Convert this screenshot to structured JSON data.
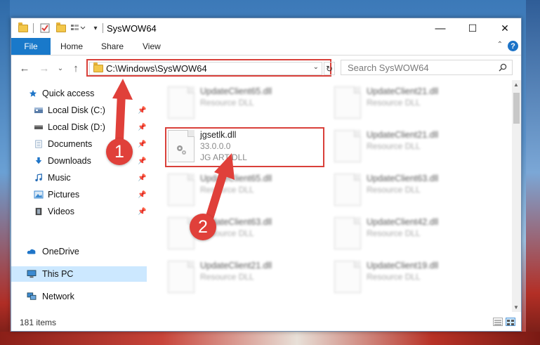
{
  "window": {
    "title": "SysWOW64",
    "controls": {
      "minimize": "—",
      "maximize": "☐",
      "close": "✕"
    }
  },
  "ribbon": {
    "tabs": [
      "File",
      "Home",
      "Share",
      "View"
    ],
    "help": "?",
    "collapse": "⌃"
  },
  "navigation": {
    "back": "←",
    "forward": "→",
    "recent": "⌄",
    "up": "↑",
    "address": "C:\\Windows\\SysWOW64",
    "refresh": "↻",
    "search_placeholder": "Search SysWOW64"
  },
  "sidebar": {
    "items": [
      {
        "label": "Quick access",
        "icon": "star-icon",
        "color": "#1f75c8",
        "pinned": false
      },
      {
        "label": "Local Disk (C:)",
        "icon": "drive-icon",
        "color": "#5a7da8",
        "pinned": true
      },
      {
        "label": "Local Disk (D:)",
        "icon": "drive-icon",
        "color": "#5a5a5a",
        "pinned": true
      },
      {
        "label": "Documents",
        "icon": "documents-icon",
        "color": "#8aa6c4",
        "pinned": true
      },
      {
        "label": "Downloads",
        "icon": "download-arrow-icon",
        "color": "#1f75c8",
        "pinned": true
      },
      {
        "label": "Music",
        "icon": "music-note-icon",
        "color": "#2a6fb7",
        "pinned": true
      },
      {
        "label": "Pictures",
        "icon": "pictures-icon",
        "color": "#3c8ad1",
        "pinned": true
      },
      {
        "label": "Videos",
        "icon": "film-icon",
        "color": "#444444",
        "pinned": true
      },
      {
        "label": "OneDrive",
        "icon": "cloud-icon",
        "color": "#1f75c8",
        "pinned": false
      },
      {
        "label": "This PC",
        "icon": "computer-icon",
        "color": "#3c8ad1",
        "pinned": false,
        "selected": true
      },
      {
        "label": "Network",
        "icon": "network-icon",
        "color": "#3c8ad1",
        "pinned": false
      }
    ],
    "pin_glyph": "📌"
  },
  "files": {
    "left_column": [
      {
        "name": "UpdateClient65.dll",
        "sub": "Resource DLL",
        "blurred": true
      },
      {
        "name": "jgsetlk.dll",
        "version": "33.0.0.0",
        "desc": "JG ART DLL",
        "blurred": false
      },
      {
        "name": "UpdateClient65.dll",
        "sub": "Resource DLL",
        "blurred": true
      },
      {
        "name": "UpdateClient63.dll",
        "sub": "Resource DLL",
        "blurred": true
      },
      {
        "name": "UpdateClient21.dll",
        "sub": "Resource DLL",
        "blurred": true
      }
    ],
    "right_column": [
      {
        "name": "UpdateClient21.dll",
        "sub": "Resource DLL"
      },
      {
        "name": "UpdateClient21.dll",
        "sub": "Resource DLL"
      },
      {
        "name": "UpdateClient63.dll",
        "sub": "Resource DLL"
      },
      {
        "name": "UpdateClient42.dll",
        "sub": "Resource DLL"
      },
      {
        "name": "UpdateClient19.dll",
        "sub": "Resource DLL"
      }
    ]
  },
  "status": {
    "item_count": "181 items"
  },
  "callouts": {
    "one": "1",
    "two": "2",
    "color": "#e0403a"
  }
}
